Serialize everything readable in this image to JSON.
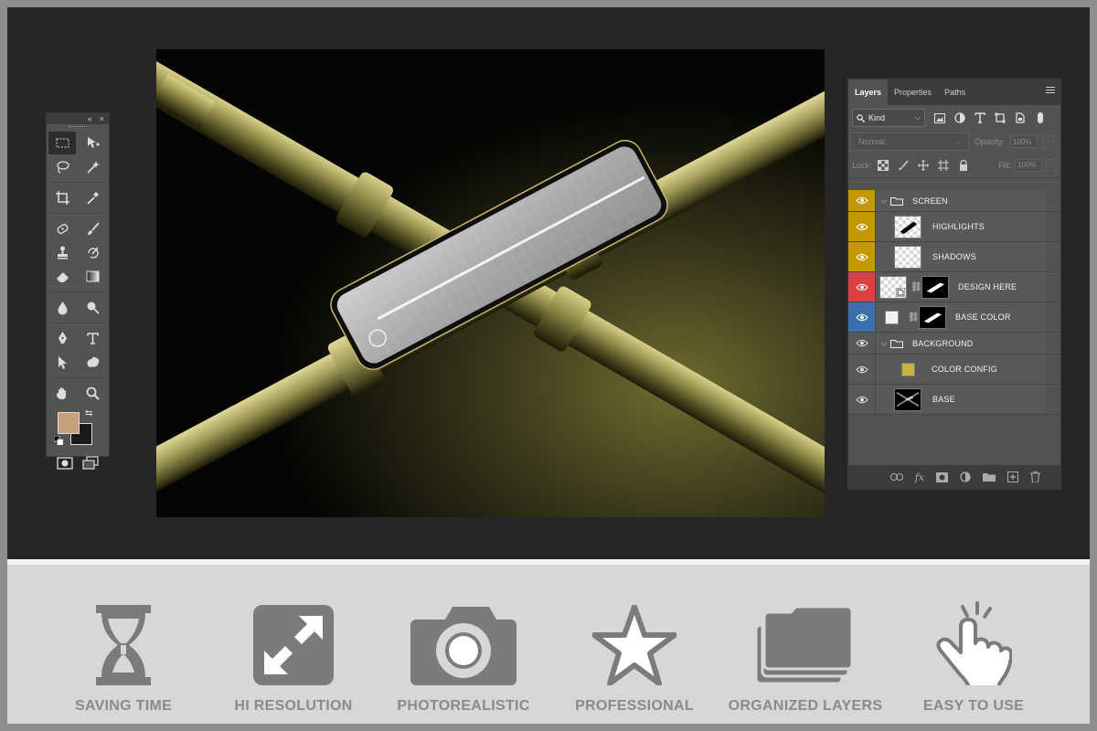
{
  "tools_panel": {
    "collapse_glyph": "«",
    "close_glyph": "×",
    "tools": [
      {
        "name": "marquee-tool-icon",
        "active": true
      },
      {
        "name": "move-tool-icon"
      },
      {
        "name": "lasso-tool-icon"
      },
      {
        "name": "magic-wand-tool-icon"
      },
      {
        "name": "crop-tool-icon"
      },
      {
        "name": "eyedropper-tool-icon"
      },
      {
        "name": "healing-brush-tool-icon"
      },
      {
        "name": "brush-tool-icon"
      },
      {
        "name": "clone-stamp-tool-icon"
      },
      {
        "name": "history-brush-tool-icon"
      },
      {
        "name": "eraser-tool-icon"
      },
      {
        "name": "gradient-tool-icon"
      },
      {
        "name": "blur-tool-icon"
      },
      {
        "name": "dodge-tool-icon"
      },
      {
        "name": "pen-tool-icon"
      },
      {
        "name": "type-tool-icon"
      },
      {
        "name": "path-selection-tool-icon"
      },
      {
        "name": "custom-shape-tool-icon"
      },
      {
        "name": "hand-tool-icon"
      },
      {
        "name": "zoom-tool-icon"
      }
    ],
    "foreground_color": "#c9a07a",
    "background_color": "#1a1a1a"
  },
  "layers_panel": {
    "tabs": [
      {
        "label": "Layers",
        "active": true
      },
      {
        "label": "Properties"
      },
      {
        "label": "Paths"
      }
    ],
    "filter": {
      "kind_label": "Kind"
    },
    "blend_mode": "Normal",
    "opacity_label": "Opacity:",
    "opacity_value": "100%",
    "lock_label": "Lock:",
    "fill_label": "Fill:",
    "fill_value": "100%",
    "layers": [
      {
        "name": "SCREEN",
        "type": "group",
        "eye_color": "gold"
      },
      {
        "name": "HIGHLIGHTS",
        "type": "layer",
        "eye_color": "gold",
        "thumb": "highlight"
      },
      {
        "name": "SHADOWS",
        "type": "layer",
        "eye_color": "gold",
        "thumb": "checker"
      },
      {
        "name": "DESIGN HERE",
        "type": "smart",
        "eye_color": "red",
        "thumb": "checker",
        "mask": true
      },
      {
        "name": "BASE COLOR",
        "type": "fill",
        "eye_color": "blue",
        "thumb": "white",
        "mask": true
      },
      {
        "name": "BACKGROUND",
        "type": "group",
        "eye_color": "plain"
      },
      {
        "name": "COLOR CONFIG",
        "type": "color",
        "eye_color": "plain",
        "swatch": "#c8b43c"
      },
      {
        "name": "BASE",
        "type": "layer",
        "eye_color": "plain",
        "thumb": "dark"
      }
    ]
  },
  "features": [
    {
      "label": "SAVING TIME",
      "icon": "hourglass-icon"
    },
    {
      "label": "HI RESOLUTION",
      "icon": "expand-icon"
    },
    {
      "label": "PHOTOREALISTIC",
      "icon": "camera-icon"
    },
    {
      "label": "PROFESSIONAL",
      "icon": "star-icon"
    },
    {
      "label": "ORGANIZED LAYERS",
      "icon": "layers-folder-icon"
    },
    {
      "label": "EASY TO USE",
      "icon": "tap-hand-icon"
    }
  ],
  "colors": {
    "eye_gold": "#c49800",
    "eye_red": "#d94241",
    "eye_blue": "#3a6fb0",
    "feature_gray": "#7b7b7b"
  }
}
